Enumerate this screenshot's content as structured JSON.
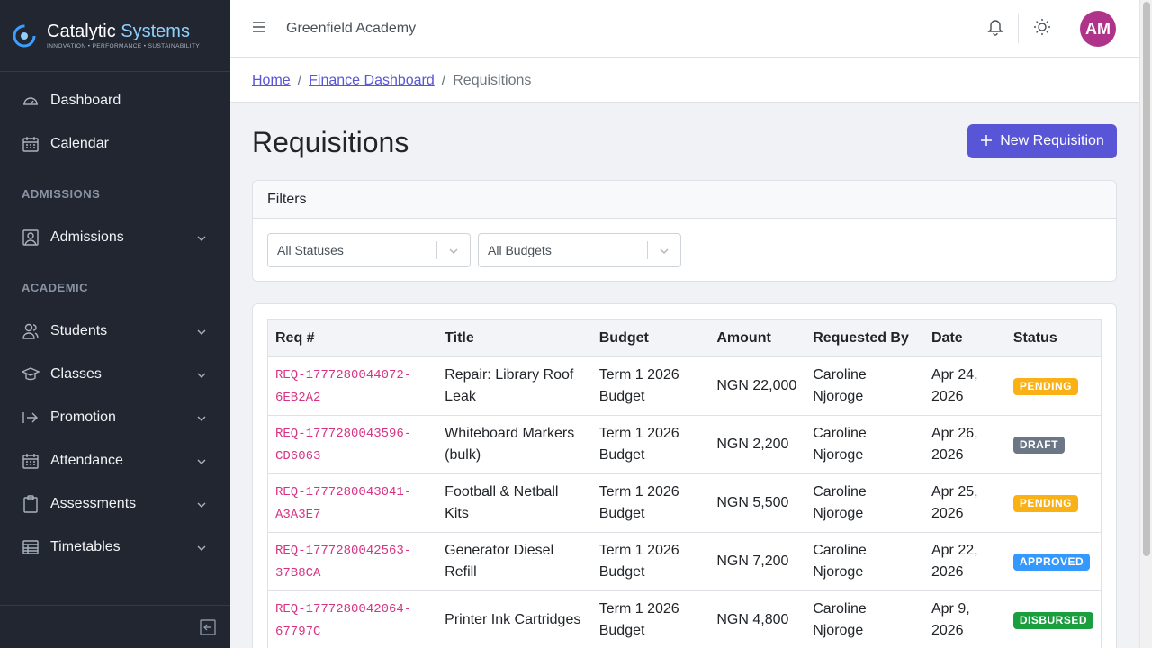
{
  "brand": {
    "name_part1": "Catalytic",
    "name_part2": "Systems",
    "tagline": "INNOVATION • PERFORMANCE • SUSTAINABILITY",
    "accent_color": "#8fd0ff"
  },
  "sidebar": {
    "items": [
      {
        "label": "Dashboard",
        "icon": "speedometer-icon"
      },
      {
        "label": "Calendar",
        "icon": "calendar-icon"
      }
    ],
    "sections": [
      {
        "title": "ADMISSIONS",
        "items": [
          {
            "label": "Admissions",
            "icon": "user-frame-icon"
          }
        ]
      },
      {
        "title": "ACADEMIC",
        "items": [
          {
            "label": "Students",
            "icon": "people-icon"
          },
          {
            "label": "Classes",
            "icon": "graduation-cap-icon"
          },
          {
            "label": "Promotion",
            "icon": "arrow-right-icon"
          },
          {
            "label": "Attendance",
            "icon": "calendar-icon"
          },
          {
            "label": "Assessments",
            "icon": "clipboard-icon"
          },
          {
            "label": "Timetables",
            "icon": "grid-table-icon"
          }
        ]
      }
    ]
  },
  "header": {
    "org_name": "Greenfield Academy",
    "avatar_initials": "AM",
    "avatar_color": "#b0338a"
  },
  "breadcrumb": {
    "home": "Home",
    "finance": "Finance Dashboard",
    "current": "Requisitions",
    "separator": "/"
  },
  "page": {
    "title": "Requisitions",
    "new_button": "New Requisition",
    "primary_color": "#5856d6"
  },
  "filters": {
    "title": "Filters",
    "status_select": "All Statuses",
    "budget_select": "All Budgets"
  },
  "table": {
    "columns": [
      "Req #",
      "Title",
      "Budget",
      "Amount",
      "Requested By",
      "Date",
      "Status"
    ],
    "rows": [
      {
        "req": "REQ-1777280044072-6EB2A2",
        "req_l1": "REQ-1777280044072-",
        "req_l2": "6EB2A2",
        "title": "Repair: Library Roof Leak",
        "budget": "Term 1 2026 Budget",
        "amount": "NGN 22,000",
        "requested_by": "Caroline Njoroge",
        "date": "Apr 24, 2026",
        "status": "PENDING"
      },
      {
        "req": "REQ-1777280043596-CD6063",
        "req_l1": "REQ-1777280043596-",
        "req_l2": "CD6063",
        "title": "Whiteboard Markers (bulk)",
        "budget": "Term 1 2026 Budget",
        "amount": "NGN 2,200",
        "requested_by": "Caroline Njoroge",
        "date": "Apr 26, 2026",
        "status": "DRAFT"
      },
      {
        "req": "REQ-1777280043041-A3A3E7",
        "req_l1": "REQ-1777280043041-",
        "req_l2": "A3A3E7",
        "title": "Football & Netball Kits",
        "budget": "Term 1 2026 Budget",
        "amount": "NGN 5,500",
        "requested_by": "Caroline Njoroge",
        "date": "Apr 25, 2026",
        "status": "PENDING"
      },
      {
        "req": "REQ-1777280042563-37B8CA",
        "req_l1": "REQ-1777280042563-",
        "req_l2": "37B8CA",
        "title": "Generator Diesel Refill",
        "budget": "Term 1 2026 Budget",
        "amount": "NGN 7,200",
        "requested_by": "Caroline Njoroge",
        "date": "Apr 22, 2026",
        "status": "APPROVED"
      },
      {
        "req": "REQ-1777280042064-67797C",
        "req_l1": "REQ-1777280042064-",
        "req_l2": "67797C",
        "title": "Printer Ink Cartridges",
        "budget": "Term 1 2026 Budget",
        "amount": "NGN 4,800",
        "requested_by": "Caroline Njoroge",
        "date": "Apr 9, 2026",
        "status": "DISBURSED"
      }
    ]
  },
  "status_colors": {
    "PENDING": {
      "bg": "#f9b115",
      "fg": "#ffffff"
    },
    "DRAFT": {
      "bg": "#6b7785",
      "fg": "#ffffff"
    },
    "APPROVED": {
      "bg": "#3399ff",
      "fg": "#ffffff"
    },
    "DISBURSED": {
      "bg": "#1b9e3e",
      "fg": "#ffffff"
    }
  }
}
